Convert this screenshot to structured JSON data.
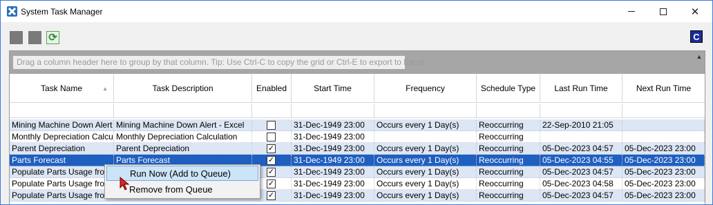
{
  "window": {
    "title": "System Task Manager"
  },
  "toolbar": {
    "c_label": "C",
    "refresh_icon": "refresh-icon"
  },
  "grid": {
    "group_hint": "Drag a column header here to group by that column. Tip: Use Ctrl-C to copy the grid or Ctrl-E to export to Excel",
    "columns": [
      "Task Name",
      "Task Description",
      "Enabled",
      "Start Time",
      "Frequency",
      "Schedule Type",
      "Last Run Time",
      "Next Run Time"
    ],
    "rows": [
      {
        "name": "Mining Machine Down Alert - Excel",
        "desc": "Mining Machine Down Alert - Excel",
        "enabled": false,
        "start": "31-Dec-1949 23:00",
        "freq": "Occurs every 1 Day(s)",
        "sched": "Reoccurring",
        "last": "22-Sep-2010 21:05",
        "next": ""
      },
      {
        "name": "Monthly Depreciation Calculation",
        "desc": "Monthly Depreciation Calculation",
        "enabled": false,
        "start": "31-Dec-1949 23:00",
        "freq": "",
        "sched": "Reoccurring",
        "last": "",
        "next": ""
      },
      {
        "name": "Parent Depreciation",
        "desc": "Parent Depreciation",
        "enabled": true,
        "start": "31-Dec-1949 23:00",
        "freq": "Occurs every 1 Day(s)",
        "sched": "Reoccurring",
        "last": "05-Dec-2023 04:57",
        "next": "05-Dec-2023 23:00"
      },
      {
        "name": "Parts Forecast",
        "desc": "Parts Forecast",
        "enabled": true,
        "start": "31-Dec-1949 23:00",
        "freq": "Occurs every 1 Day(s)",
        "sched": "Reoccurring",
        "last": "05-Dec-2023 04:55",
        "next": "05-Dec-2023 23:00"
      },
      {
        "name": "Populate Parts Usage from",
        "desc": "",
        "enabled": true,
        "start": "31-Dec-1949 23:00",
        "freq": "Occurs every 1 Day(s)",
        "sched": "Reoccurring",
        "last": "05-Dec-2023 04:57",
        "next": "05-Dec-2023 23:00"
      },
      {
        "name": "Populate Parts Usage from",
        "desc": "",
        "enabled": true,
        "start": "31-Dec-1949 23:00",
        "freq": "Occurs every 1 Day(s)",
        "sched": "Reoccurring",
        "last": "05-Dec-2023 04:58",
        "next": "05-Dec-2023 23:00"
      },
      {
        "name": "Populate Parts Usage from",
        "desc": "",
        "enabled": true,
        "start": "31-Dec-1949 23:00",
        "freq": "Occurs every 1 Day(s)",
        "sched": "Reoccurring",
        "last": "05-Dec-2023 04:57",
        "next": "05-Dec-2023 23:00"
      }
    ]
  },
  "context_menu": {
    "run_now": "Run Now (Add to Queue)",
    "remove": "Remove from Queue"
  },
  "colors": {
    "selected_row": "#1f5fbf",
    "alt_row": "#dce6f4",
    "menu_highlight": "#cce4f7"
  }
}
